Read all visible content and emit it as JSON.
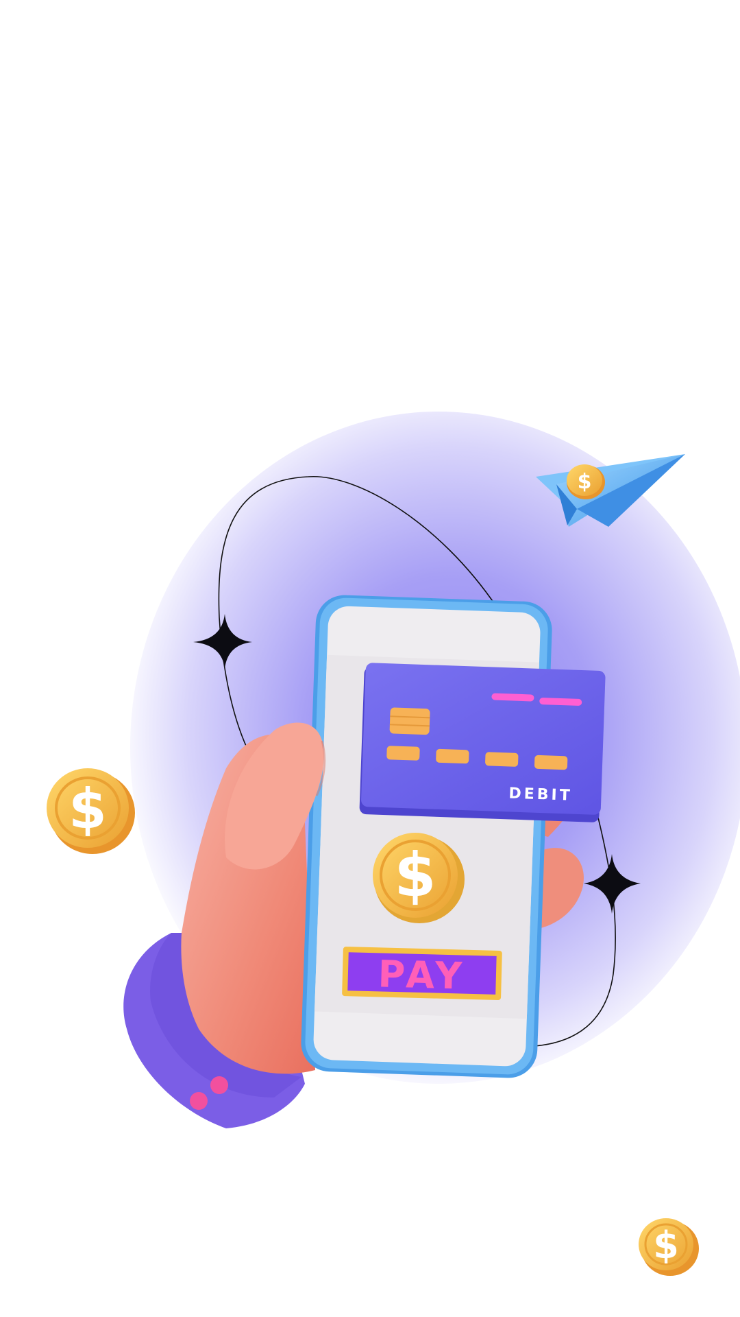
{
  "illustration": {
    "card_label": "DEBIT",
    "pay_label": "PAY",
    "currency_symbol": "$"
  },
  "colors": {
    "glow": "#8e84f2",
    "phone_frame": "#5aaef0",
    "phone_screen": "#efedf0",
    "card": "#6d64ea",
    "card_stripe": "#ff5fd2",
    "card_chip": "#f7b256",
    "coin": "#f6c043",
    "coin_dark": "#e8952c",
    "pay_bar": "#8e3ef0",
    "pay_text": "#ff5fb8",
    "hand": "#f2907e",
    "sleeve": "#7b5ee6",
    "plane": "#6ab8f2"
  },
  "icons": [
    "dollar-coin-icon",
    "paper-plane-icon",
    "sparkle-star-icon",
    "credit-card-icon",
    "smartphone-icon"
  ]
}
